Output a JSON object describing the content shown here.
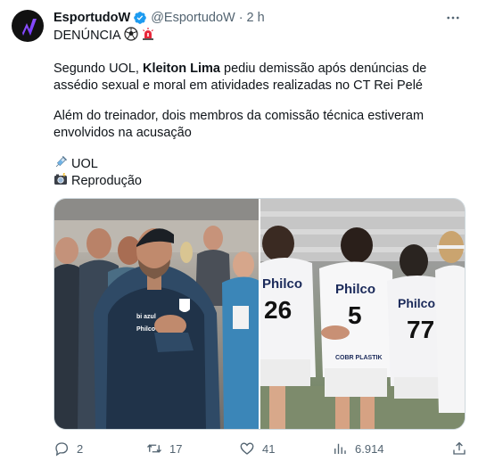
{
  "author": {
    "name": "EsportudoW",
    "handle": "@EsportudoW",
    "time": "2 h"
  },
  "tweet": {
    "line1": "DENÚNCIA",
    "para1_pre": "Segundo UOL, ",
    "para1_bold": "Kleiton Lima",
    "para1_post": " pediu demissão após denúncias de assédio sexual e moral em atividades realizadas no CT Rei Pelé",
    "para2": "Além do treinador, dois membros da comissão técnica estiveram envolvidos na acusação",
    "credit1": "UOL",
    "credit2": "Reprodução"
  },
  "photo_text": {
    "jersey_brand": "Philco",
    "numbers": [
      "26",
      "5",
      "77"
    ],
    "sponsor": "COBR PLASTIK",
    "coach_badge": "bi azul",
    "coach_sponsor": "Philco"
  },
  "actions": {
    "replies": "2",
    "retweets": "17",
    "likes": "41",
    "views": "6.914"
  },
  "colors": {
    "verified": "#1d9bf0",
    "muted": "#536471",
    "text": "#0f1419"
  }
}
